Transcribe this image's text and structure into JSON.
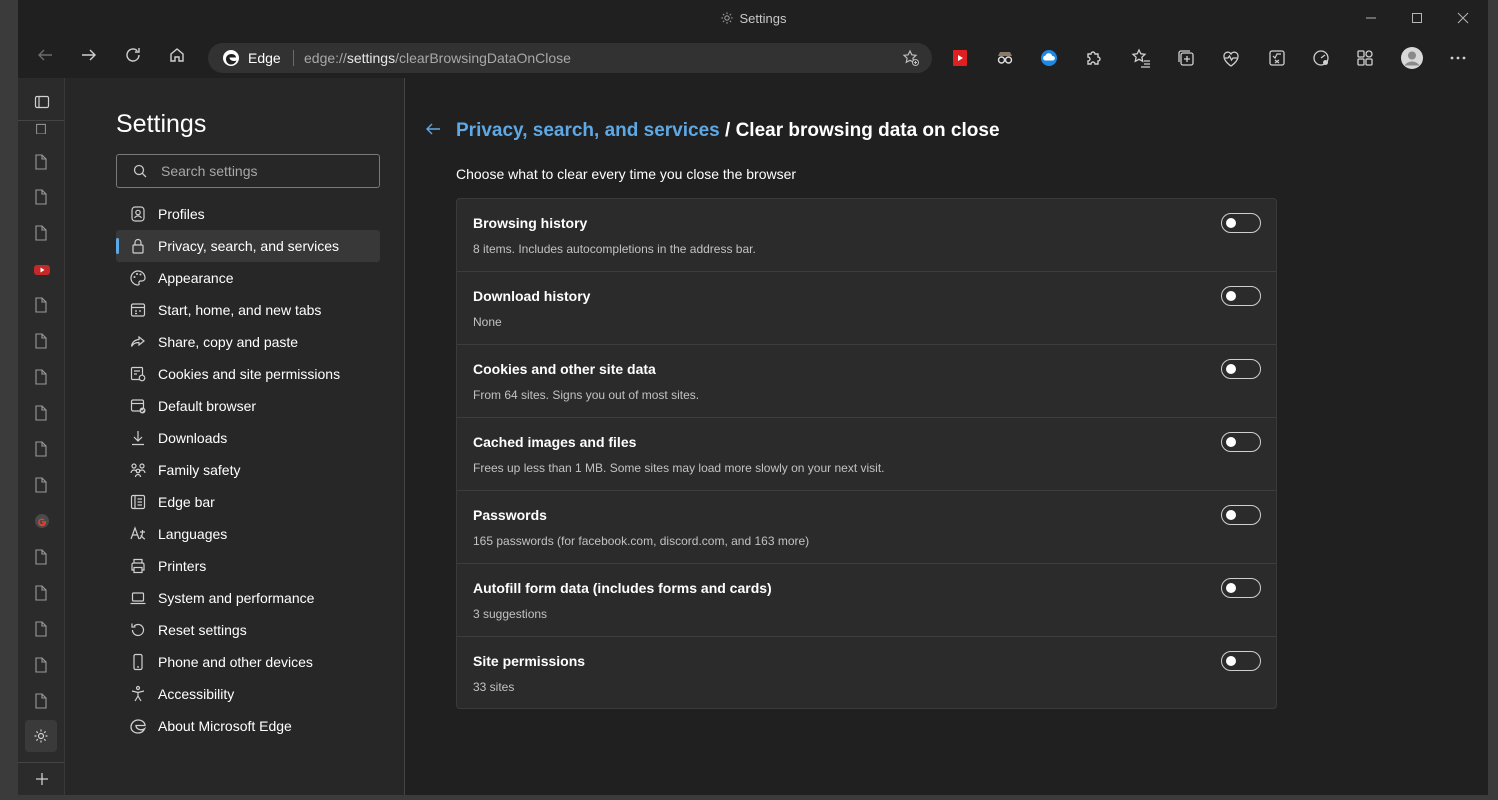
{
  "window": {
    "title": "Settings"
  },
  "addressbar": {
    "brand": "Edge",
    "url_scheme": "edge://",
    "url_host": "settings",
    "url_path": "/clearBrowsingDataOnClose"
  },
  "settings": {
    "title": "Settings",
    "search_placeholder": "Search settings",
    "nav": [
      {
        "label": "Profiles",
        "icon": "profile-icon"
      },
      {
        "label": "Privacy, search, and services",
        "icon": "lock-icon",
        "active": true
      },
      {
        "label": "Appearance",
        "icon": "palette-icon"
      },
      {
        "label": "Start, home, and new tabs",
        "icon": "start-icon"
      },
      {
        "label": "Share, copy and paste",
        "icon": "share-icon"
      },
      {
        "label": "Cookies and site permissions",
        "icon": "cookies-icon"
      },
      {
        "label": "Default browser",
        "icon": "default-browser-icon"
      },
      {
        "label": "Downloads",
        "icon": "download-icon"
      },
      {
        "label": "Family safety",
        "icon": "family-icon"
      },
      {
        "label": "Edge bar",
        "icon": "edge-bar-icon"
      },
      {
        "label": "Languages",
        "icon": "languages-icon"
      },
      {
        "label": "Printers",
        "icon": "printer-icon"
      },
      {
        "label": "System and performance",
        "icon": "laptop-icon"
      },
      {
        "label": "Reset settings",
        "icon": "reset-icon"
      },
      {
        "label": "Phone and other devices",
        "icon": "phone-icon"
      },
      {
        "label": "Accessibility",
        "icon": "accessibility-icon"
      },
      {
        "label": "About Microsoft Edge",
        "icon": "edge-logo-icon"
      }
    ]
  },
  "main": {
    "breadcrumb_parent": "Privacy, search, and services",
    "breadcrumb_separator": "/",
    "breadcrumb_current": "Clear browsing data on close",
    "description": "Choose what to clear every time you close the browser",
    "options": [
      {
        "title": "Browsing history",
        "desc": "8 items. Includes autocompletions in the address bar.",
        "on": false
      },
      {
        "title": "Download history",
        "desc": "None",
        "on": false
      },
      {
        "title": "Cookies and other site data",
        "desc": "From 64 sites. Signs you out of most sites.",
        "on": false
      },
      {
        "title": "Cached images and files",
        "desc": "Frees up less than 1 MB. Some sites may load more slowly on your next visit.",
        "on": false
      },
      {
        "title": "Passwords",
        "desc": "165 passwords (for facebook.com, discord.com, and 163 more)",
        "on": false
      },
      {
        "title": "Autofill form data (includes forms and cards)",
        "desc": "3 suggestions",
        "on": false
      },
      {
        "title": "Site permissions",
        "desc": "33 sites",
        "on": false
      }
    ]
  },
  "colors": {
    "accent": "#5ea8e6",
    "background": "#202020",
    "card": "#2b2b2b"
  }
}
